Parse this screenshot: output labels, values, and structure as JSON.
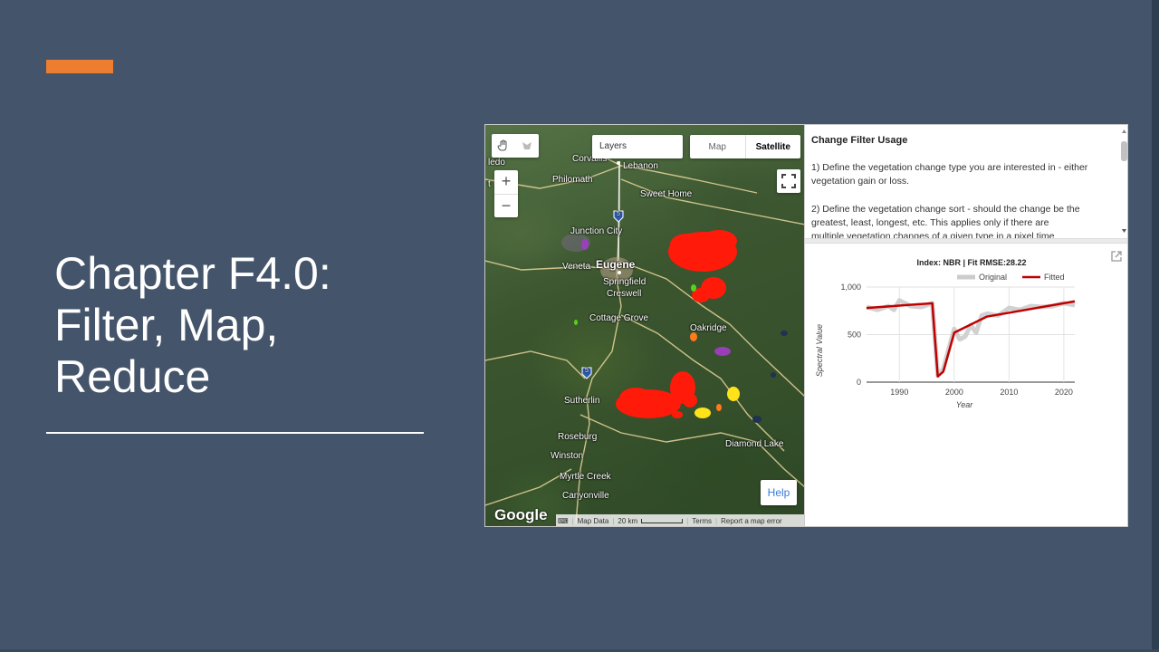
{
  "slide": {
    "title_lines": [
      "Chapter F4.0:",
      "Filter, Map,",
      "Reduce"
    ],
    "colors": {
      "background": "#44546a",
      "accent": "#ed7d31",
      "text": "#ffffff"
    }
  },
  "map": {
    "layers_label": "Layers",
    "map_type_map": "Map",
    "map_type_satellite": "Satellite",
    "zoom_in": "+",
    "zoom_out": "−",
    "help_label": "Help",
    "google_logo": "Google",
    "attribution": {
      "map_data": "Map Data",
      "scale": "20 km",
      "terms": "Terms",
      "report": "Report a map error"
    },
    "places": {
      "ledo": "ledo",
      "corvallis": "Corvallis",
      "lebanon": "Lebanon",
      "philomath": "Philomath",
      "sweet_home": "Sweet Home",
      "junction_city": "Junction City",
      "veneta": "Veneta",
      "eugene": "Eugene",
      "springfield": "Springfield",
      "creswell": "Creswell",
      "cottage_grove": "Cottage Grove",
      "oakridge": "Oakridge",
      "sutherlin": "Sutherlin",
      "roseburg": "Roseburg",
      "winston": "Winston",
      "myrtle_creek": "Myrtle Creek",
      "canyonville": "Canyonville",
      "diamond_lake": "Diamond Lake",
      "t": "t",
      "route_5a": "5",
      "route_5b": "5"
    }
  },
  "info_panel": {
    "title": "Change Filter Usage",
    "step1": "1) Define the vegetation change type you are interested in - either vegetation gain or loss.",
    "step2": "2) Define the vegetation change sort - should the change be the greatest, least, longest, etc. This applies only if there are",
    "step2_cut": "multiple vegetation changes of a given type in a pixel time"
  },
  "chart_data": {
    "type": "line",
    "title": "Index: NBR | Fit RMSE:28.22",
    "xlabel": "Year",
    "ylabel": "Spectral Value",
    "xlim": [
      1984,
      2022
    ],
    "ylim": [
      0,
      1000
    ],
    "x_ticks": [
      "1990",
      "2000",
      "2010",
      "2020"
    ],
    "y_ticks": [
      "0",
      "500",
      "1,000"
    ],
    "legend_position": "top",
    "series": [
      {
        "name": "Original",
        "color": "#cccccc",
        "x": [
          1984,
          1986,
          1988,
          1989,
          1990,
          1992,
          1994,
          1996,
          1997,
          1998,
          1999,
          2000,
          2001,
          2002,
          2003,
          2004,
          2005,
          2006,
          2008,
          2010,
          2012,
          2014,
          2016,
          2018,
          2020,
          2022
        ],
        "y": [
          790,
          760,
          800,
          760,
          860,
          800,
          790,
          830,
          70,
          140,
          350,
          560,
          450,
          480,
          600,
          520,
          700,
          720,
          700,
          780,
          760,
          800,
          790,
          800,
          830,
          810
        ]
      },
      {
        "name": "Fitted",
        "color": "#c00000",
        "x": [
          1984,
          1996,
          1997,
          1998,
          2000,
          2006,
          2022
        ],
        "y": [
          780,
          830,
          60,
          110,
          520,
          690,
          850
        ]
      }
    ]
  }
}
